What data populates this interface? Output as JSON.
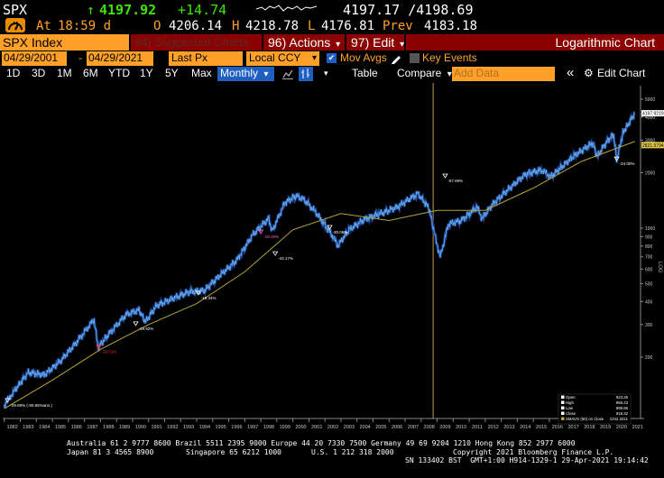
{
  "quote": {
    "ticker": "SPX",
    "last": "4197.92",
    "change": "+14.74",
    "bid_ask": "4197.17 /4198.69",
    "at_label": "At",
    "time": "18:59 d",
    "open_label": "O",
    "open": "4206.14",
    "high_label": "H",
    "high": "4218.78",
    "low_label": "L",
    "low": "4176.81",
    "prev_label": "Prev",
    "prev": "4183.18",
    "up_arrow": "↑"
  },
  "toolbar": {
    "security": "SPX Index",
    "suggested": "94) Suggested Charts",
    "actions": "96) Actions",
    "edit": "97) Edit",
    "chart_type": "Logarithmic Chart",
    "dropdown_arrow": "▾"
  },
  "params": {
    "start_date": "04/29/2001",
    "dash": "-",
    "end_date": "04/29/2021",
    "field": "Last Px",
    "currency": "Local CCY",
    "mov_avgs_label": "Mov Avgs",
    "key_events_label": "Key Events",
    "check": "✔"
  },
  "periods": {
    "items": [
      "1D",
      "3D",
      "1M",
      "6M",
      "YTD",
      "1Y",
      "5Y",
      "Max"
    ],
    "frequency": "Monthly",
    "table": "Table",
    "compare": "Compare",
    "add_data_placeholder": "Add Data",
    "edit_chart": "Edit Chart",
    "collapse": "«",
    "settings_glyph": "⚙"
  },
  "chart_data": {
    "type": "line",
    "scale": "log",
    "ylabel": "LOG",
    "x_ticks": [
      "1982",
      "1983",
      "1984",
      "1985",
      "1986",
      "1987",
      "1988",
      "1989",
      "1990",
      "1991",
      "1992",
      "1993",
      "1994",
      "1995",
      "1996",
      "1997",
      "1998",
      "1999",
      "2000",
      "2001",
      "2002",
      "2003",
      "2004",
      "2005",
      "2006",
      "2007",
      "2008",
      "2009",
      "2010",
      "2011",
      "2012",
      "2013",
      "2014",
      "2015",
      "2016",
      "2017",
      "2018",
      "2019",
      "2020",
      "2021"
    ],
    "y_ticks": [
      200,
      300,
      400,
      500,
      600,
      700,
      800,
      900,
      1000,
      2000,
      3000,
      4000,
      5000
    ],
    "ylim": [
      95,
      5600
    ],
    "xlim": [
      1981.9,
      2021.35
    ],
    "price": {
      "x": [
        1982.0,
        1982.6,
        1983.5,
        1984.5,
        1985.5,
        1986.5,
        1987.6,
        1987.85,
        1988.5,
        1989.6,
        1990.4,
        1990.8,
        1991.5,
        1992.5,
        1993.5,
        1994.5,
        1995.5,
        1996.5,
        1997.5,
        1998.5,
        1998.7,
        1999.5,
        2000.2,
        2000.7,
        2001.5,
        2002.5,
        2002.8,
        2003.5,
        2004.5,
        2005.5,
        2006.5,
        2007.8,
        2008.5,
        2008.9,
        2009.2,
        2009.7,
        2010.5,
        2011.5,
        2011.8,
        2012.5,
        2013.5,
        2014.5,
        2015.5,
        2016.1,
        2016.8,
        2017.5,
        2018.7,
        2018.98,
        2019.6,
        2020.0,
        2020.2,
        2020.6,
        2021.0,
        2021.33
      ],
      "y": [
        110,
        130,
        165,
        160,
        190,
        240,
        320,
        225,
        265,
        340,
        360,
        310,
        380,
        415,
        450,
        460,
        560,
        670,
        920,
        1130,
        960,
        1370,
        1500,
        1430,
        1200,
        900,
        800,
        980,
        1120,
        1200,
        1300,
        1540,
        1280,
        880,
        700,
        1050,
        1100,
        1300,
        1130,
        1360,
        1640,
        1960,
        2070,
        1900,
        2150,
        2450,
        2900,
        2450,
        2950,
        3230,
        2350,
        3300,
        3750,
        4198
      ]
    },
    "moving_average": {
      "name": "SMAVG (60) on Close 1242.3221",
      "x": [
        1982.0,
        1985.0,
        1988.0,
        1991.0,
        1994.0,
        1997.0,
        2000.0,
        2003.0,
        2006.0,
        2009.0,
        2012.0,
        2015.0,
        2018.0,
        2021.33
      ],
      "y": [
        105,
        150,
        220,
        300,
        390,
        580,
        980,
        1200,
        1100,
        1250,
        1250,
        1650,
        2300,
        2950
      ]
    },
    "value_labels": [
      {
        "text": "4197.9219",
        "y": 4197.92,
        "bg": "#ffffff",
        "fg": "#000000"
      },
      {
        "text": "2821.5794",
        "y": 2821.58,
        "bg": "#e2c54a",
        "fg": "#000000"
      }
    ],
    "drawdowns": [
      {
        "text": "-29.89% (-90.65%ann.)",
        "x": 1982.2,
        "y": 115,
        "color": "#ffffff"
      },
      {
        "text": "-33.51%",
        "x": 1987.9,
        "y": 225,
        "color": "#ff3030"
      },
      {
        "text": "-19.92%",
        "x": 1990.2,
        "y": 300,
        "color": "#ffffff"
      },
      {
        "text": "-19.34%",
        "x": 1994.1,
        "y": 440,
        "color": "#ffffff"
      },
      {
        "text": "-19.19%",
        "x": 1998.0,
        "y": 945,
        "color": "#ff66cc"
      },
      {
        "text": "-43.17%",
        "x": 1998.9,
        "y": 720,
        "color": "#ffffff"
      },
      {
        "text": "-30.06%",
        "x": 2002.3,
        "y": 1000,
        "color": "#ffffff"
      },
      {
        "text": "-57.69%",
        "x": 2009.5,
        "y": 1900,
        "color": "#ffffff"
      },
      {
        "text": "-34.00%",
        "x": 2020.2,
        "y": 2350,
        "color": "#ffffff"
      }
    ],
    "vertical_marker_x": 2008.75,
    "legend": {
      "rows": [
        {
          "label": "Open",
          "value": "923.26"
        },
        {
          "label": "High",
          "value": "956.23"
        },
        {
          "label": "Low",
          "value": "888.86"
        },
        {
          "label": "Close",
          "value": "919.32"
        },
        {
          "label": "SMAVG (60) on Close",
          "value": "1242.3221"
        }
      ]
    },
    "colors": {
      "price": "#5fa3e8",
      "price_dark": "#1c3f8a",
      "ma": "#b7a43a",
      "marker": "#c49a50",
      "axis": "#888888",
      "grid": "#333333"
    }
  },
  "footer": {
    "line1": "Australia 61 2 9777 8600 Brazil 5511 2395 9000 Europe 44 20 7330 7500 Germany 49 69 9204 1210 Hong Kong 852 2977 6000",
    "line2a": "Japan 81 3 4565 8900",
    "line2b": "Singapore 65 6212 1000",
    "line2c": "U.S. 1 212 318 2000",
    "line2d": "Copyright 2021 Bloomberg Finance L.P.",
    "line3": "SN 133402 BST  GMT+1:00 H914-1329-1 29-Apr-2021 19:14:42"
  },
  "colors": {
    "orange": "#ffa028",
    "up": "#3ce600",
    "maroon": "#8b0000",
    "amber": "#e68c00",
    "blue": "#1e5fbf"
  }
}
